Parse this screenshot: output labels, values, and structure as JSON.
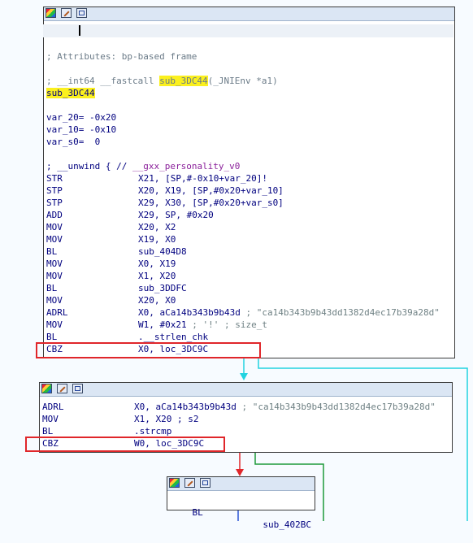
{
  "node1": {
    "comment_attributes": "; Attributes: bp-based frame",
    "proto_prefix": "; __int64 __fastcall ",
    "proto_name": "sub_3DC44",
    "proto_suffix": "(_JNIEnv *a1)",
    "label": "sub_3DC44",
    "vars": [
      "var_20= -0x20",
      "var_10= -0x10",
      "var_s0=  0"
    ],
    "unwind_prefix": "; __unwind { // ",
    "unwind_name": "__gxx_personality_v0",
    "instructions": [
      {
        "mn": "STR",
        "op": "X21, [SP,#-0x10+var_20]!"
      },
      {
        "mn": "STP",
        "op": "X20, X19, [SP,#0x20+var_10]"
      },
      {
        "mn": "STP",
        "op": "X29, X30, [SP,#0x20+var_s0]"
      },
      {
        "mn": "ADD",
        "op": "X29, SP, #0x20"
      },
      {
        "mn": "MOV",
        "op": "X20, X2"
      },
      {
        "mn": "MOV",
        "op": "X19, X0"
      },
      {
        "mn": "BL",
        "op": "sub_404D8"
      },
      {
        "mn": "MOV",
        "op": "X0, X19"
      },
      {
        "mn": "MOV",
        "op": "X1, X20"
      },
      {
        "mn": "BL",
        "op": "sub_3DDFC"
      },
      {
        "mn": "MOV",
        "op": "X20, X0"
      },
      {
        "mn": "ADRL",
        "op": "X0, aCa14b343b9b43d",
        "cmt": " ; \"ca14b343b9b43dd1382d4ec17b39a28d\""
      },
      {
        "mn": "MOV",
        "op": "W1, #0x21",
        "cmt": " ; '!' ; size_t"
      },
      {
        "mn": "BL",
        "op": ".__strlen_chk"
      },
      {
        "mn": "CBZ",
        "op": "X0, loc_3DC9C"
      }
    ]
  },
  "node2": {
    "instructions": [
      {
        "mn": "ADRL",
        "op": "X0, aCa14b343b9b43d",
        "cmt": " ; \"ca14b343b9b43dd1382d4ec17b39a28d\""
      },
      {
        "mn": "MOV",
        "op": "X1, X20 ; s2"
      },
      {
        "mn": "BL",
        "op": ".strcmp"
      },
      {
        "mn": "CBZ",
        "op": "W0, loc_3DC9C"
      }
    ]
  },
  "node3": {
    "mn": "BL",
    "op": "sub_402BC"
  },
  "colors": {
    "background": "#f7fbff",
    "highlight_yellow": "#fbf01e",
    "highlight_box_red": "#e0262a",
    "edge_true_cyan": "#22d3e0",
    "edge_false_green": "#1f9a3a",
    "edge_red": "#e0262a",
    "edge_blue": "#2a55d6",
    "instruction_blue": "#00007f"
  }
}
